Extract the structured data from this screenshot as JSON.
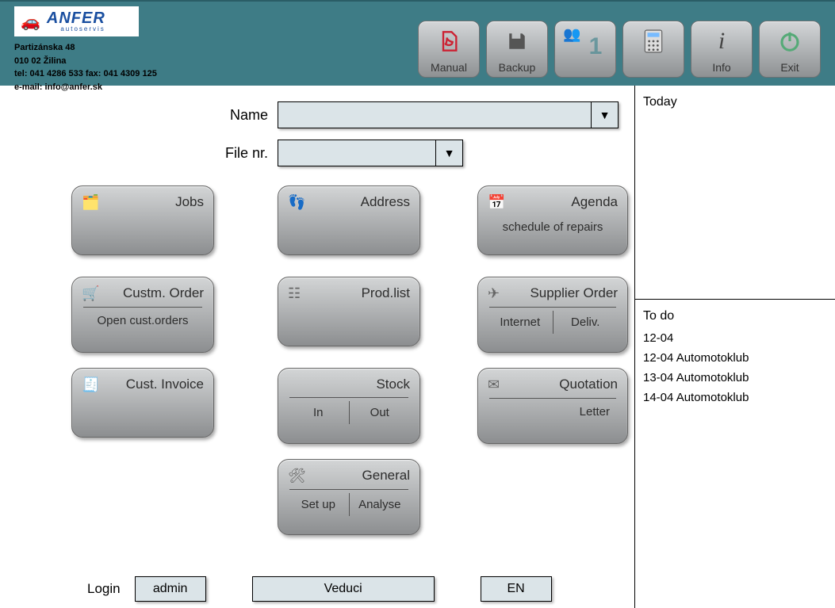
{
  "header": {
    "brand": "ANFER",
    "brand_sub": "autoservis",
    "addr_line1": "Partizánska 48",
    "addr_line2": "010 02 Žilina",
    "addr_line3": "tel: 041 4286 533  fax: 041 4309 125",
    "addr_line4": "e-mail: info@anfer.sk",
    "buttons": {
      "manual": "Manual",
      "backup": "Backup",
      "session_number": "1",
      "info": "Info",
      "exit": "Exit"
    }
  },
  "form": {
    "name_label": "Name",
    "file_label": "File nr."
  },
  "tiles": {
    "jobs": "Jobs",
    "address": "Address",
    "agenda_title": "Agenda",
    "agenda_sub": "schedule of repairs",
    "cust_order_title": "Custm. Order",
    "cust_order_sub": "Open cust.orders",
    "prodlist": "Prod.list",
    "supplier_title": "Supplier Order",
    "supplier_left": "Internet",
    "supplier_right": "Deliv.",
    "cust_invoice": "Cust. Invoice",
    "stock_title": "Stock",
    "stock_left": "In",
    "stock_right": "Out",
    "quotation_title": "Quotation",
    "quotation_sub": "Letter",
    "general_title": "General",
    "general_left": "Set up",
    "general_right": "Analyse"
  },
  "login": {
    "label": "Login",
    "user": "admin",
    "role": "Veduci",
    "lang": "EN"
  },
  "side": {
    "today": "Today",
    "todo_title": "To do",
    "todo": [
      "12-04",
      "12-04  Automotoklub",
      "13-04  Automotoklub",
      "14-04  Automotoklub"
    ]
  }
}
